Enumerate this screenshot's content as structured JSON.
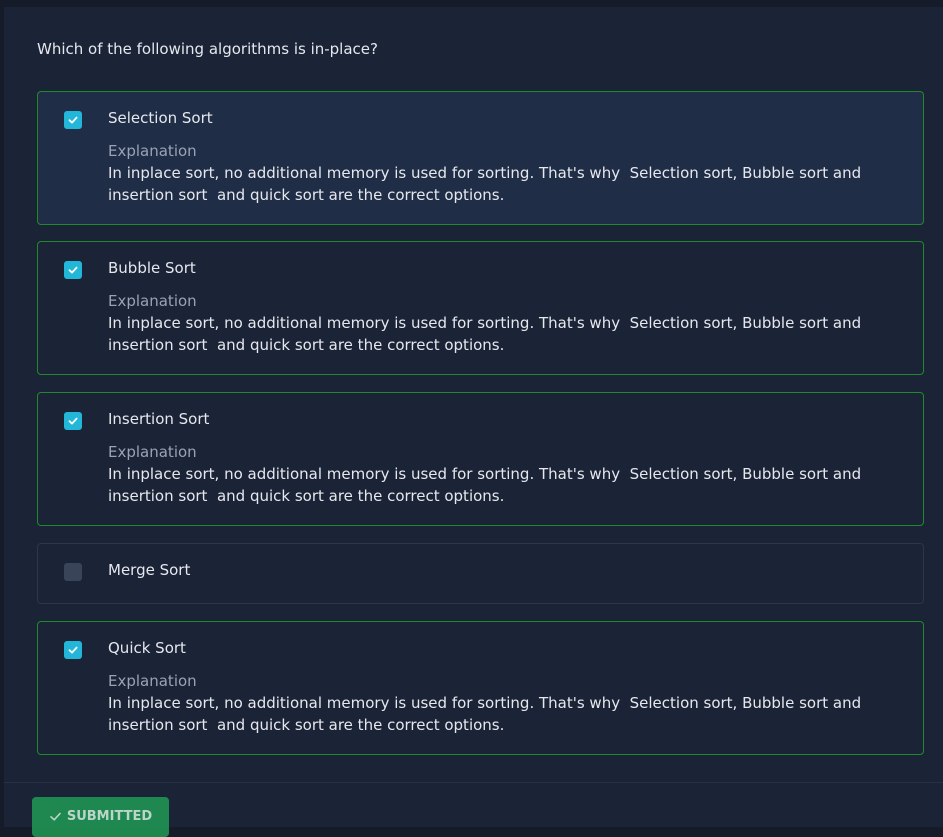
{
  "question": "Which of the following algorithms is in-place?",
  "explanation_title": "Explanation",
  "options": [
    {
      "label": "Selection Sort",
      "checked": true,
      "explanation": "In inplace sort, no additional memory is used for sorting. That's why  Selection sort, Bubble sort and insertion sort  and quick sort are the correct options."
    },
    {
      "label": "Bubble Sort",
      "checked": true,
      "explanation": "In inplace sort, no additional memory is used for sorting. That's why  Selection sort, Bubble sort and insertion sort  and quick sort are the correct options."
    },
    {
      "label": "Insertion Sort",
      "checked": true,
      "explanation": "In inplace sort, no additional memory is used for sorting. That's why  Selection sort, Bubble sort and insertion sort  and quick sort are the correct options."
    },
    {
      "label": "Merge Sort",
      "checked": false,
      "explanation": ""
    },
    {
      "label": "Quick Sort",
      "checked": true,
      "explanation": "In inplace sort, no additional memory is used for sorting. That's why  Selection sort, Bubble sort and insertion sort  and quick sort are the correct options."
    }
  ],
  "submit": {
    "label": "SUBMITTED",
    "icon": "check-icon"
  },
  "colors": {
    "correct_border": "#1f8a2a",
    "checkbox_checked": "#22b7d8",
    "submitted_button": "#1f9a55"
  }
}
